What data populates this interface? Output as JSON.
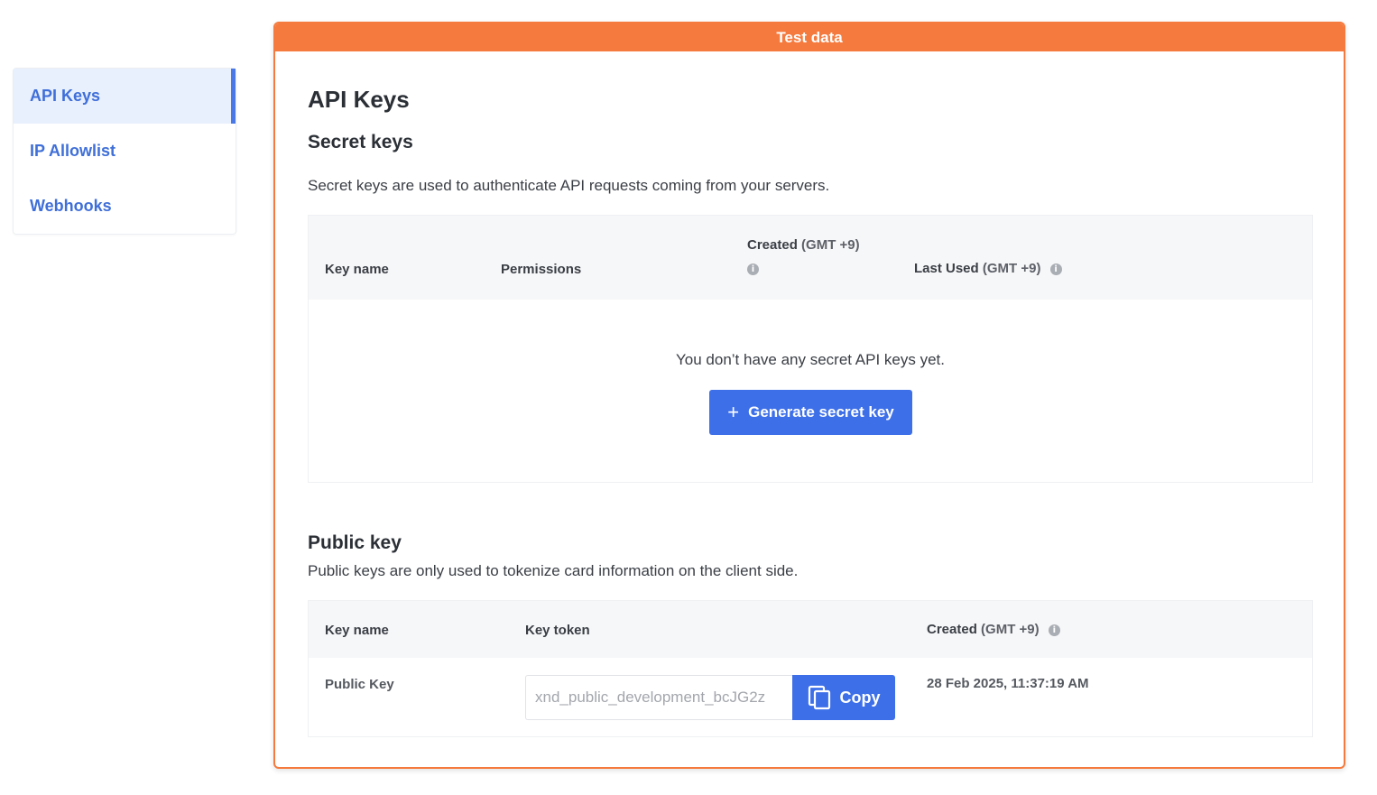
{
  "sidebar": {
    "items": [
      {
        "label": "API Keys",
        "active": true
      },
      {
        "label": "IP Allowlist",
        "active": false
      },
      {
        "label": "Webhooks",
        "active": false
      }
    ]
  },
  "banner": {
    "label": "Test data"
  },
  "page": {
    "title": "API Keys"
  },
  "secret_keys": {
    "heading": "Secret keys",
    "description": "Secret keys are used to authenticate API requests coming from your servers.",
    "columns": {
      "key_name": "Key name",
      "permissions": "Permissions",
      "created": "Created",
      "created_tz": "(GMT +9)",
      "last_used": "Last Used",
      "last_used_tz": "(GMT +9)"
    },
    "empty_text": "You don’t have any secret API keys yet.",
    "generate_button": "Generate secret key"
  },
  "public_key": {
    "heading": "Public key",
    "description": "Public keys are only used to tokenize card information on the client side.",
    "columns": {
      "key_name": "Key name",
      "key_token": "Key token",
      "created": "Created",
      "created_tz": "(GMT +9)"
    },
    "rows": [
      {
        "key_name": "Public Key",
        "token": "xnd_public_development_bcJG2z",
        "created": "28 Feb 2025, 11:37:19 AM"
      }
    ],
    "copy_button": "Copy"
  },
  "colors": {
    "accent": "#3d6fe8",
    "banner": "#f57a3d",
    "sidebar_active_bg": "#e8effd"
  }
}
